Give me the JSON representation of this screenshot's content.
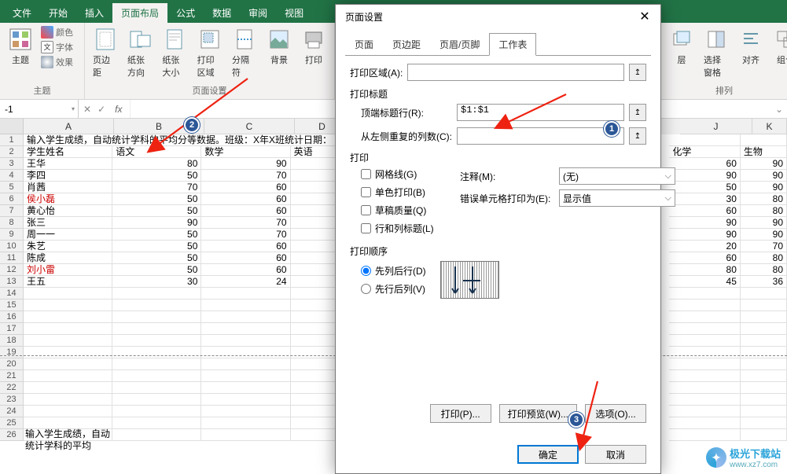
{
  "ribbon": {
    "tabs": [
      "文件",
      "开始",
      "插入",
      "页面布局",
      "公式",
      "数据",
      "审阅",
      "视图"
    ],
    "active": "页面布局",
    "theme_group": {
      "main": "主题",
      "colors": "颜色",
      "fonts": "字体",
      "effects": "效果",
      "label": "主题"
    },
    "pagesetup_group": {
      "buttons": [
        "页边距",
        "纸张方向",
        "纸张大小",
        "打印区域",
        "分隔符",
        "背景",
        "打印"
      ],
      "label": "页面设置"
    },
    "arrange_group": {
      "b1": "层",
      "b2": "选择窗格",
      "b3": "对齐",
      "b4": "组合",
      "label": "排列"
    }
  },
  "formula_bar": {
    "namebox": "-1",
    "fx": "fx"
  },
  "columns": {
    "A": 115,
    "B": 115,
    "C": 115,
    "D": 70,
    "H": 30,
    "I": 92,
    "J": 92,
    "K": 60
  },
  "sheet": {
    "title_row": "输入学生成绩，自动统计学科的平均分等数据。班级：X年X班统计日期：",
    "headers": [
      "学生姓名",
      "语文",
      "数学",
      "英语",
      "化学",
      "生物"
    ],
    "rows": [
      {
        "name": "王华",
        "vals": [
          80,
          90,
          60,
          90
        ]
      },
      {
        "name": "李四",
        "vals": [
          50,
          70,
          90,
          90
        ]
      },
      {
        "name": "肖茜",
        "vals": [
          70,
          60,
          50,
          90
        ]
      },
      {
        "name": "侯小磊",
        "red": true,
        "vals": [
          50,
          60,
          30,
          80
        ]
      },
      {
        "name": "黄心怡",
        "vals": [
          50,
          60,
          60,
          80
        ]
      },
      {
        "name": "张三",
        "vals": [
          90,
          70,
          90,
          90
        ]
      },
      {
        "name": "周一一",
        "vals": [
          50,
          70,
          90,
          90
        ]
      },
      {
        "name": "朱艺",
        "vals": [
          50,
          60,
          20,
          70
        ]
      },
      {
        "name": "陈成",
        "vals": [
          50,
          60,
          60,
          80
        ]
      },
      {
        "name": "刘小雷",
        "red": true,
        "vals": [
          50,
          60,
          80,
          80
        ]
      },
      {
        "name": "王五",
        "vals": [
          30,
          24,
          45,
          36
        ]
      }
    ]
  },
  "footer_text": "输入学生成绩，自动统计学科的平均",
  "dialog": {
    "title": "页面设置",
    "tabs": [
      "页面",
      "页边距",
      "页眉/页脚",
      "工作表"
    ],
    "active": "工作表",
    "print_area_label": "打印区域(A):",
    "print_title_label": "打印标题",
    "top_row_label": "顶端标题行(R):",
    "top_row_value": "$1:$1",
    "left_col_label": "从左侧重复的列数(C):",
    "print_label": "打印",
    "check_grid": "网格线(G)",
    "check_bw": "单色打印(B)",
    "check_draft": "草稿质量(Q)",
    "check_rowcol": "行和列标题(L)",
    "comments_label": "注释(M):",
    "comments_value": "(无)",
    "errors_label": "错误单元格打印为(E):",
    "errors_value": "显示值",
    "order_label": "打印顺序",
    "order_down": "先列后行(D)",
    "order_over": "先行后列(V)",
    "btn_print": "打印(P)...",
    "btn_preview": "打印预览(W)...",
    "btn_options": "选项(O)...",
    "btn_ok": "确定",
    "btn_cancel": "取消"
  },
  "watermark": {
    "text": "极光下载站",
    "url": "www.xz7.com"
  }
}
